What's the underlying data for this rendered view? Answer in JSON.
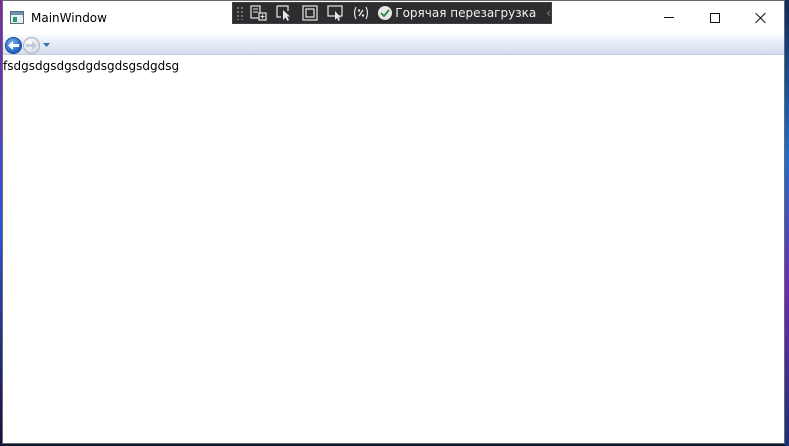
{
  "window": {
    "title": "MainWindow"
  },
  "devtoolbar": {
    "hot_reload_label": "Горячая перезагрузка",
    "hot_reload_status_color": "#e6e6e6"
  },
  "icons": {
    "app": "app-window-icon",
    "back": "back-arrow-icon",
    "forward": "forward-arrow-icon",
    "nav_menu": "chevron-down-icon",
    "minimize": "minimize-icon",
    "maximize": "maximize-icon",
    "close": "close-icon",
    "hot_reload": "checkmark-circle-icon",
    "collapse": "chevron-left-icon"
  },
  "content": {
    "text": "fsdgsdgsdgsdgdsgdsgsdgdsg"
  },
  "colors": {
    "accent_back_button": "#1f62c4",
    "devbar_background": "#2d2d30"
  }
}
